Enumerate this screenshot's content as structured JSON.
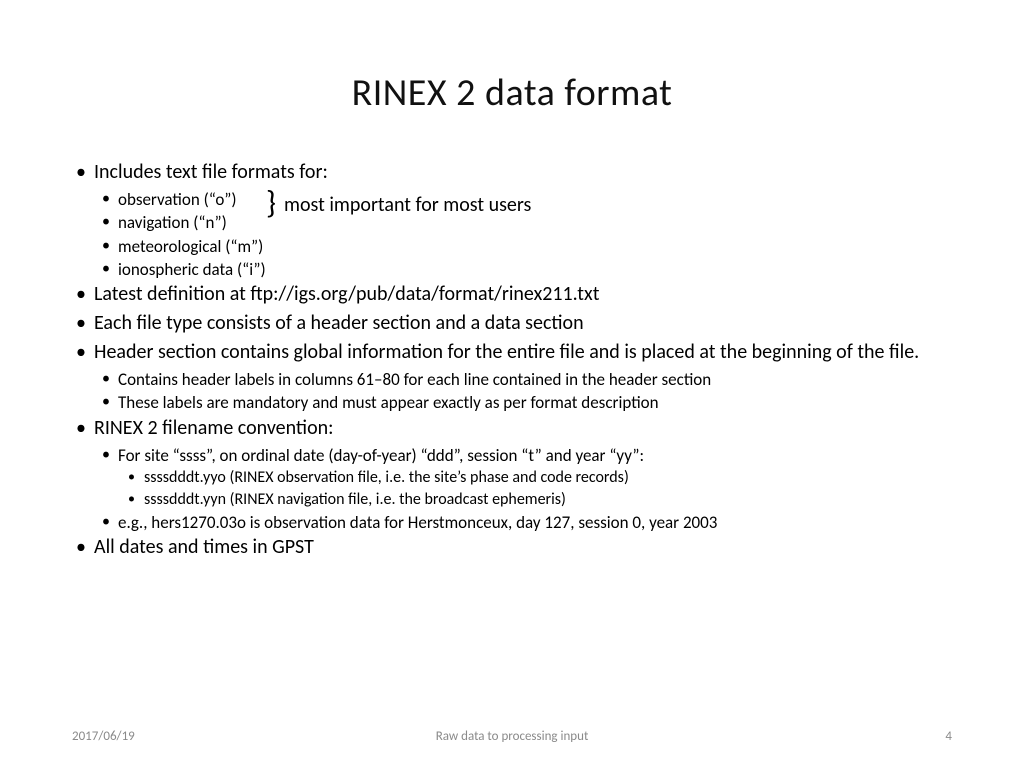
{
  "title": "RINEX 2 data format",
  "b1": "Includes text file formats for:",
  "s1a": "observation (“o”)",
  "s1b": "navigation (“n”)",
  "s1c": "meteorological (“m”)",
  "s1d": "ionospheric data (“i”)",
  "brace_note": "most important for most users",
  "b2": "Latest definition at ftp://igs.org/pub/data/format/rinex211.txt",
  "b3": "Each file type consists of a header section and a data section",
  "b4": "Header section contains global information for the entire file and is placed at the beginning of the file.",
  "s4a": "Contains header labels in columns 61–80 for each line contained in the header section",
  "s4b": "These labels are mandatory and must appear exactly as per format description",
  "b5": "RINEX 2 filename convention:",
  "s5a": "For site “ssss”, on ordinal date (day-of-year) “ddd”, session “t” and year “yy”:",
  "t5a1": "ssssdddt.yyo (RINEX observation file, i.e. the site’s phase and code records)",
  "t5a2": "ssssdddt.yyn (RINEX navigation file, i.e. the broadcast ephemeris)",
  "s5b": "e.g., hers1270.03o is observation data for Herstmonceux, day 127, session 0, year 2003",
  "b6": "All dates and times in GPST",
  "footer_date": "2017/06/19",
  "footer_title": "Raw data to processing input",
  "footer_page": "4"
}
